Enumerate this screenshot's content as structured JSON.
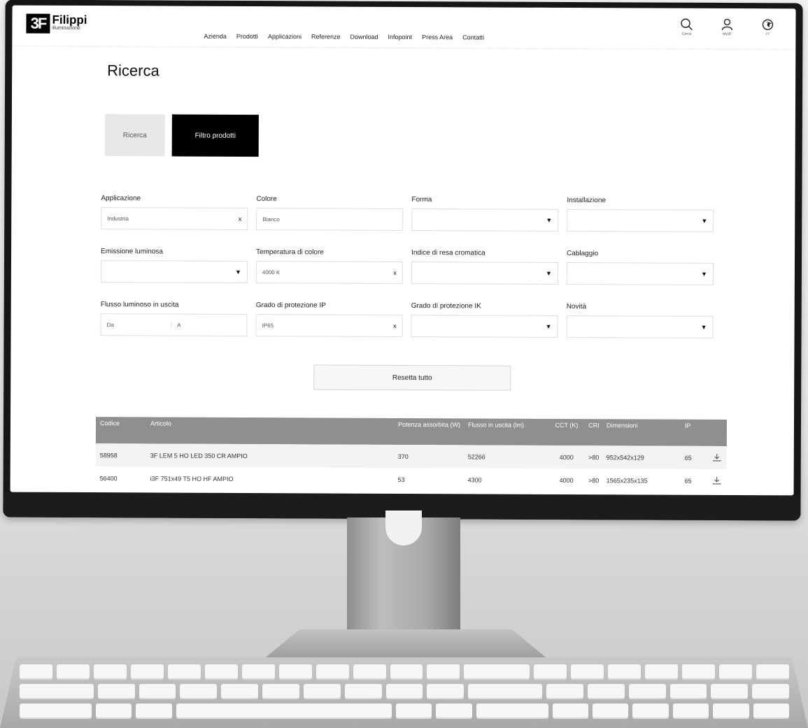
{
  "brand": {
    "mark": "3F",
    "name": "Filippi",
    "sub": "illuminazione"
  },
  "nav": [
    "Azienda",
    "Prodotti",
    "Applicazioni",
    "Referenze",
    "Download",
    "Infopoint",
    "Press Area",
    "Contatti"
  ],
  "util": {
    "search": "Cerca",
    "account": "My3F",
    "lang": "IT"
  },
  "page_title": "Ricerca",
  "tabs": {
    "search": "Ricerca",
    "filter": "Filtro prodotti"
  },
  "filters": {
    "applicazione": {
      "label": "Applicazione",
      "value": "Industria"
    },
    "colore": {
      "label": "Colore",
      "value": "Bianco"
    },
    "forma": {
      "label": "Forma",
      "value": ""
    },
    "installazione": {
      "label": "Installazione",
      "value": ""
    },
    "emissione": {
      "label": "Emissione luminosa",
      "value": ""
    },
    "temperatura": {
      "label": "Temperatura di colore",
      "value": "4000 K"
    },
    "indice": {
      "label": "Indice di resa cromatica",
      "value": ""
    },
    "cablaggio": {
      "label": "Cablaggio",
      "value": ""
    },
    "flusso": {
      "label": "Flusso luminoso in uscita",
      "from": "Da",
      "to": "A"
    },
    "ip": {
      "label": "Grado di protezione IP",
      "value": "IP65"
    },
    "ik": {
      "label": "Grado di protezione IK",
      "value": ""
    },
    "novita": {
      "label": "Novità",
      "value": ""
    }
  },
  "clear_glyph": "x",
  "dropdown_glyph": "▼",
  "reset_label": "Resetta tutto",
  "table": {
    "headers": [
      "Codice",
      "Articolo",
      "Potenza assorbita (W)",
      "Flusso in uscita (lm)",
      "CCT (K)",
      "CRI",
      "Dimensioni",
      "IP"
    ],
    "rows": [
      [
        "58958",
        "3F LEM 5 HO LED 350 CR AMPIO",
        "370",
        "52266",
        "4000",
        ">80",
        "952x542x129",
        "65"
      ],
      [
        "56400",
        "i3F 751x49 T5 HO HF AMPIO",
        "53",
        "4300",
        "4000",
        ">80",
        "1565x235x135",
        "65"
      ]
    ]
  }
}
